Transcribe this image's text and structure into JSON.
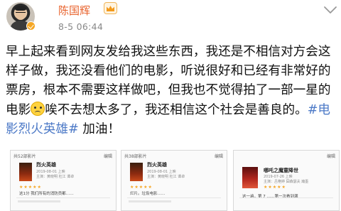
{
  "author": {
    "name": "陈国辉",
    "time": "8-5 06:44"
  },
  "post": {
    "text": "早上起来看到网友发给我这些东西，我还是不相信对方会这样子做，我还没看他们的电影，听说很好和已经有非常好的票房，根本不需要这样做吧，但我也不觉得拍了一部一星的电影",
    "text_after_emoji": "唉不去想太多了，我还相信这个社会是善良的。",
    "hashtag": "#电影烈火英雄#",
    "text_end": " 加油！"
  },
  "images": [
    {
      "header": "共52部影片",
      "edit": "编辑",
      "title": "烈火英雄",
      "meta1": "2019-08-01 上映",
      "meta2": "主演：黄晓明 杜江 谭卓",
      "stars": "★★★★★",
      "review": "这1分 我们所有的消防员都……"
    },
    {
      "header": "共38部影片",
      "edit": "编辑",
      "title": "烈火英雄",
      "meta1": "2019-08-01 上映",
      "meta2": "主演：黄晓明 杜江 谭卓",
      "stars": "★★★★★",
      "review": "烂片。垃圾电影……"
    },
    {
      "header": "",
      "edit": "编辑",
      "title": "哪吒之魔童降世",
      "meta1": "2019-07-26 上映",
      "meta2": "主演：吕艳婷 囧森瑟夫 瀚墨",
      "stars": "★★★★★",
      "review": "这一遍，第 7 ……第一次看到满"
    }
  ]
}
